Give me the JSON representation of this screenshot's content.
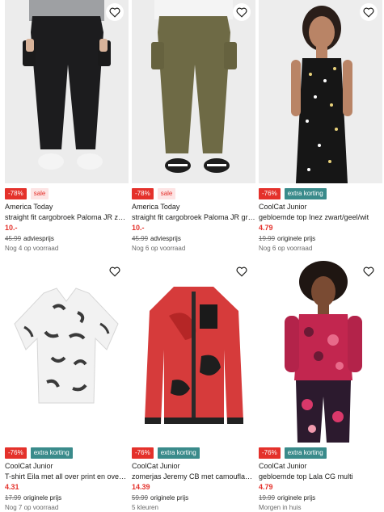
{
  "colors": {
    "discount": "#e4312b",
    "extra": "#3a8b8b",
    "sale_bg": "#fde4e4",
    "price": "#e4312b"
  },
  "products": [
    {
      "discount": "-78%",
      "tag": "sale",
      "brand": "America Today",
      "title": "straight fit cargobroek Paloma JR zwart",
      "price": "10.-",
      "old_price": "45.99",
      "price_note": "adviesprijs",
      "stock": "Nog 4 op voorraad",
      "icon": "heart-icon"
    },
    {
      "discount": "-78%",
      "tag": "sale",
      "brand": "America Today",
      "title": "straight fit cargobroek Paloma JR groen",
      "price": "10.-",
      "old_price": "45.99",
      "price_note": "adviesprijs",
      "stock": "Nog 6 op voorraad",
      "icon": "heart-icon"
    },
    {
      "discount": "-76%",
      "tag": "extra korting",
      "brand": "CoolCat Junior",
      "title": "gebloemde top Inez zwart/geel/wit",
      "price": "4.79",
      "old_price": "19.99",
      "price_note": "originele prijs",
      "stock": "Nog 6 op voorraad",
      "icon": "heart-icon"
    },
    {
      "discount": "-76%",
      "tag": "extra korting",
      "brand": "CoolCat Junior",
      "title": "T-shirt Eila met all over print en oversl...",
      "price": "4.31",
      "old_price": "17.99",
      "price_note": "originele prijs",
      "stock": "Nog 7 op voorraad",
      "icon": "heart-icon"
    },
    {
      "discount": "-76%",
      "tag": "extra korting",
      "brand": "CoolCat Junior",
      "title": "zomerjas Jeremy CB met camouflagep...",
      "price": "14.39",
      "old_price": "59.99",
      "price_note": "originele prijs",
      "stock": "5 kleuren",
      "icon": "heart-icon"
    },
    {
      "discount": "-76%",
      "tag": "extra korting",
      "brand": "CoolCat Junior",
      "title": "gebloemde top Lala CG multi",
      "price": "4.79",
      "old_price": "19.99",
      "price_note": "originele prijs",
      "stock": "Morgen in huis",
      "icon": "heart-icon"
    }
  ]
}
